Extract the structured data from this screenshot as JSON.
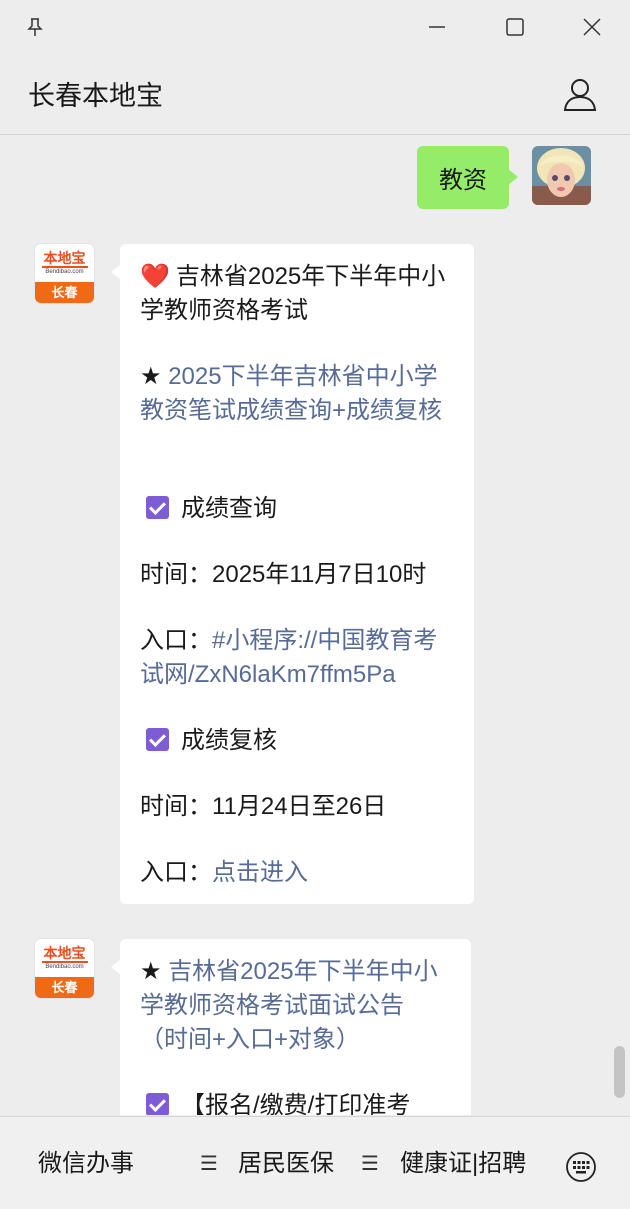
{
  "window": {
    "pin_icon": "pin-icon",
    "minimize_icon": "minimize-icon",
    "maximize_icon": "maximize-icon",
    "close_icon": "close-icon"
  },
  "header": {
    "title": "长春本地宝",
    "user_icon": "user-icon"
  },
  "messages": {
    "sent_text": "教资",
    "logo_main": "本地宝",
    "logo_sub": "Bendibao.com",
    "logo_city": "长春",
    "card1": {
      "heading": "吉林省2025年下半年中小学教师资格考试",
      "star": "★ ",
      "link_title": "2025下半年吉林省中小学教资笔试成绩查询+成绩复核",
      "section1": "成绩查询",
      "time1_label": "时间：",
      "time1_value": "2025年11月7日10时",
      "entry1_label": "入口：",
      "entry1_link": "#小程序://中国教育考试网/ZxN6laKm7ffm5Pa",
      "section2": "成绩复核",
      "time2_label": "时间：",
      "time2_value": "11月24日至26日",
      "entry2_label": "入口：",
      "entry2_link": "点击进入"
    },
    "card2": {
      "star": "★ ",
      "link_title": "吉林省2025年下半年中小学教师资格考试面试公告（时间+入口+对象）",
      "section1": "【报名/缴费/打印准考"
    }
  },
  "bottom_menu": {
    "item1": "微信办事",
    "item2": "居民医保",
    "item3": "健康证|招聘",
    "menu_icon": "menu-lines-icon",
    "keyboard_icon": "keyboard-icon"
  },
  "colors": {
    "accent_green": "#95ec69",
    "link_blue": "#576b95",
    "check_purple": "#7d5cd6",
    "logo_orange": "#f06a16"
  }
}
